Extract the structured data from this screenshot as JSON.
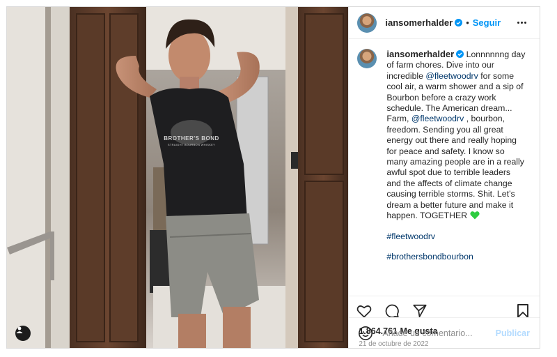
{
  "post": {
    "username": "iansomerhalder",
    "follow_label": "Seguir",
    "separator": "•",
    "caption": {
      "part1": "Lonnnnnng day of farm chores. Dive into our incredible",
      "mention1": "@fleetwoodrv",
      "part2": "for some cool air, a warm shower and a sip of Bourbon before a crazy work schedule. The American dream... Farm,",
      "mention2": "@fleetwoodrv",
      "part3": ", bourbon, freedom. Sending you all great energy out there and really hoping for peace and safety. I know so many amazing people are in a really awful spot due to terrible leaders and the affects of climate change causing terrible storms. Shit. Let’s dream a better future and make it happen. TOGETHER",
      "hashtag1": "#fleetwoodrv",
      "hashtag2": "#brothersbondbourbon"
    },
    "likes": "1.864.761 Me gusta",
    "date": "21 de octubre de 2022",
    "comment_placeholder": "Añade un comentario...",
    "publish_label": "Publicar"
  },
  "photo": {
    "shirt_text_line1": "BROTHER'S BOND",
    "shirt_text_line2": "STRAIGHT BOURBON WHISKEY"
  },
  "colors": {
    "link": "#0095f6",
    "mention": "#00376b",
    "verified": "#0095f6",
    "heart": "#2ecc40",
    "muted": "#8e8e8e"
  },
  "icons": {
    "header": [
      "verified-badge-icon",
      "more-options-icon"
    ],
    "actions": [
      "heart-icon",
      "comment-icon",
      "share-icon",
      "bookmark-icon"
    ],
    "compose": [
      "emoji-icon"
    ],
    "media": [
      "tagged-user-icon"
    ]
  }
}
